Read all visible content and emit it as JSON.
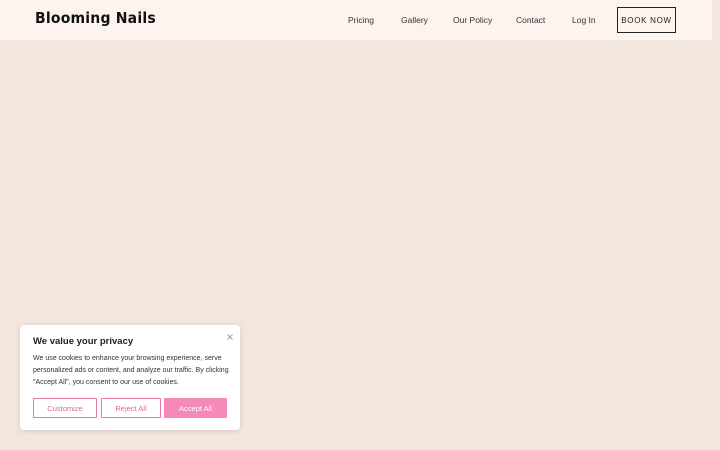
{
  "header": {
    "logo": "Blooming Nails",
    "nav": [
      {
        "label": "Pricing"
      },
      {
        "label": "Gallery"
      },
      {
        "label": "Our Policy"
      },
      {
        "label": "Contact"
      },
      {
        "label": "Log In"
      }
    ],
    "cta_label": "BOOK NOW"
  },
  "cookie_banner": {
    "title": "We value your privacy",
    "body": "We use cookies to enhance your browsing experience, serve personalized ads or content, and analyze our traffic. By clicking \"Accept All\", you consent to our use of cookies.",
    "buttons": {
      "customize": "Customize",
      "reject": "Reject All",
      "accept": "Accept All"
    },
    "close_icon": "close-icon"
  },
  "colors": {
    "page_bg": "#f2e6de",
    "header_bg": "#fdf4ef",
    "accent_pink": "#f58ab9"
  }
}
